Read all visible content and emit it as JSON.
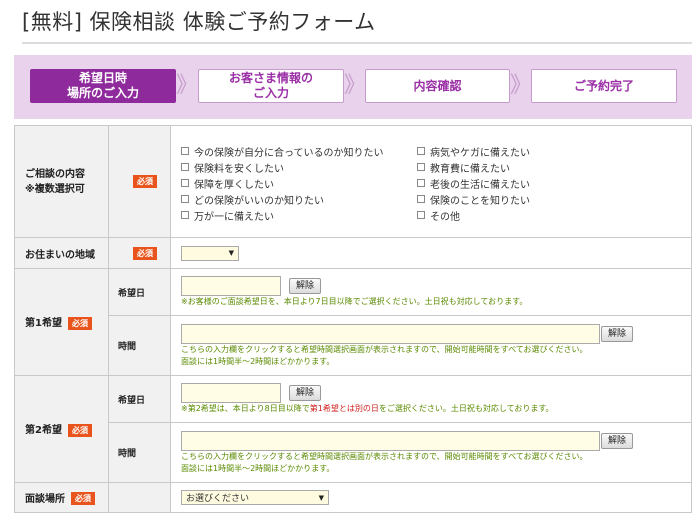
{
  "page": {
    "title": "[無料] 保険相談 体験ご予約フォーム"
  },
  "steps": [
    {
      "line1": "希望日時",
      "line2": "場所のご入力",
      "active": true
    },
    {
      "line1": "お客さま情報の",
      "line2": "ご入力",
      "active": false
    },
    {
      "line1": "内容確認",
      "line2": "",
      "active": false
    },
    {
      "line1": "ご予約完了",
      "line2": "",
      "active": false
    }
  ],
  "chevron": "》",
  "required_badge": "必須",
  "consult": {
    "label_line1": "ご相談の内容",
    "label_line2": "※複数選択可",
    "options_left": [
      "今の保険が自分に合っているのか知りたい",
      "保険料を安くしたい",
      "保障を厚くしたい",
      "どの保険がいいのか知りたい",
      "万が一に備えたい"
    ],
    "options_right": [
      "病気やケガに備えたい",
      "教育費に備えたい",
      "老後の生活に備えたい",
      "保険のことを知りたい",
      "その他"
    ]
  },
  "region": {
    "label": "お住まいの地域",
    "value": ""
  },
  "choice1": {
    "label": "第1希望",
    "date_label": "希望日",
    "time_label": "時間",
    "clear_label": "解除",
    "date_note": "※お客様のご面談希望日を、本日より7日目以降でご選択ください。土日祝も対応しております。",
    "time_note1": "こちらの入力欄をクリックすると希望時間選択画面が表示されますので、開始可能時間をすべてお選びください。",
    "time_note2": "面談には1時間半～2時間ほどかかります。"
  },
  "choice2": {
    "label": "第2希望",
    "date_label": "希望日",
    "time_label": "時間",
    "clear_label": "解除",
    "date_note_a": "※第2希望は、本日より8日目以降で",
    "date_note_red": "第1希望とは別の日",
    "date_note_b": "をご選択ください。土日祝も対応しております。",
    "time_note1": "こちらの入力欄をクリックすると希望時間選択画面が表示されますので、開始可能時間をすべてお選びください。",
    "time_note2": "面談には1時間半～2時間ほどかかります。"
  },
  "place": {
    "label": "面談場所",
    "placeholder": "お選びください"
  },
  "colors": {
    "accent": "#8f2a9c",
    "step_bg": "#e9d3ec",
    "required": "#e8541c",
    "note": "#5a8a00",
    "note_red": "#d01b1b"
  },
  "icons": {
    "dropdown": "dropdown-arrow-icon",
    "checkbox": "checkbox-icon"
  }
}
